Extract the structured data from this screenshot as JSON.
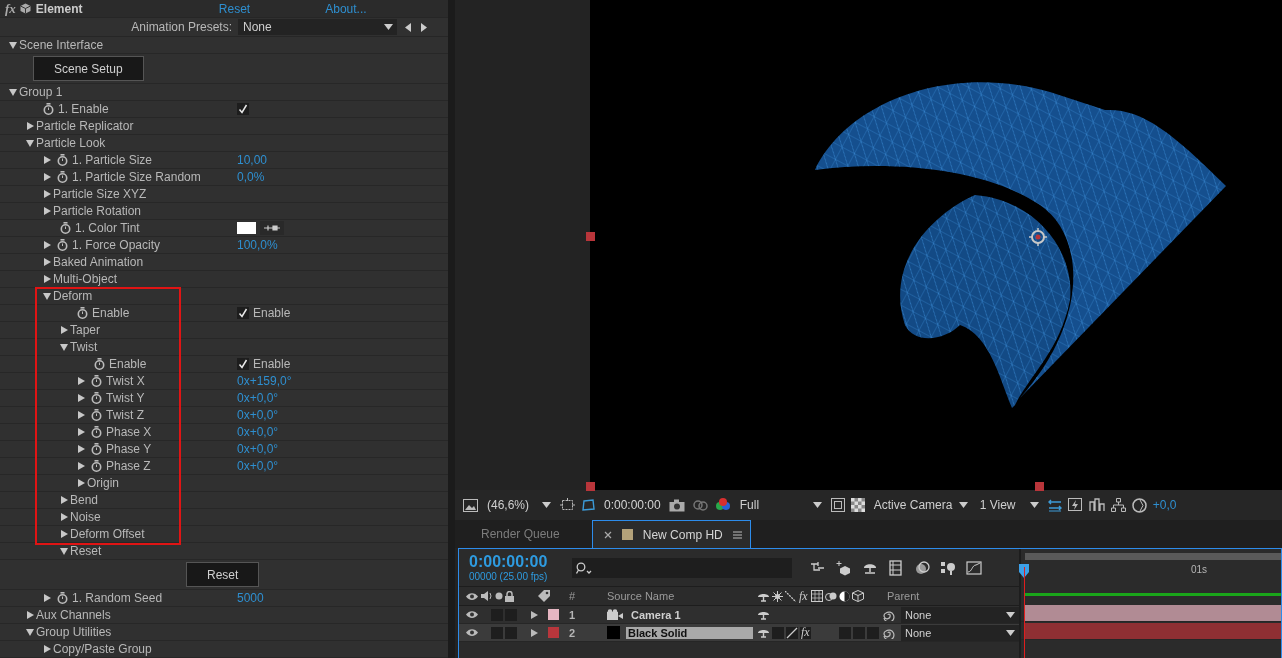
{
  "effect_panel": {
    "badge": "fx",
    "title": "Element",
    "reset_link": "Reset",
    "about_link": "About...",
    "presets_label": "Animation Presets:",
    "presets_value": "None",
    "tree": [
      {
        "kind": "group",
        "label": "Scene Interface",
        "expanded": true,
        "children": [
          {
            "kind": "button",
            "label": "Scene Setup"
          }
        ]
      },
      {
        "kind": "group",
        "label": "Group 1",
        "expanded": true,
        "children": [
          {
            "kind": "param",
            "label": "1. Enable",
            "value": {
              "kind": "checkbox",
              "checked": true
            }
          },
          {
            "kind": "group",
            "label": "Particle Replicator",
            "expanded": false
          },
          {
            "kind": "group",
            "label": "Particle Look",
            "expanded": true,
            "children": [
              {
                "kind": "param",
                "label": "1. Particle Size",
                "expanded": false,
                "value": {
                  "kind": "number",
                  "text": "10,00"
                }
              },
              {
                "kind": "param",
                "label": "1. Particle Size Random",
                "expanded": false,
                "value": {
                  "kind": "number",
                  "text": "0,0%"
                }
              },
              {
                "kind": "group",
                "label": "Particle Size XYZ",
                "expanded": false
              },
              {
                "kind": "group",
                "label": "Particle Rotation",
                "expanded": false
              },
              {
                "kind": "param",
                "label": "1. Color Tint",
                "value": {
                  "kind": "color"
                }
              },
              {
                "kind": "param",
                "label": "1. Force Opacity",
                "expanded": false,
                "value": {
                  "kind": "number",
                  "text": "100,0%"
                }
              },
              {
                "kind": "group",
                "label": "Baked Animation",
                "expanded": false
              },
              {
                "kind": "group",
                "label": "Multi-Object",
                "expanded": false
              },
              {
                "kind": "group",
                "label": "Deform",
                "expanded": true,
                "highlighted": true,
                "children": [
                  {
                    "kind": "param",
                    "label": "Enable",
                    "highlighted": true,
                    "value": {
                      "kind": "checkbox",
                      "checked": true,
                      "label": "Enable"
                    }
                  },
                  {
                    "kind": "group",
                    "label": "Taper",
                    "expanded": false,
                    "highlighted": true
                  },
                  {
                    "kind": "group",
                    "label": "Twist",
                    "expanded": true,
                    "highlighted": true,
                    "children": [
                      {
                        "kind": "param",
                        "label": "Enable",
                        "highlighted": true,
                        "value": {
                          "kind": "checkbox",
                          "checked": true,
                          "label": "Enable"
                        }
                      },
                      {
                        "kind": "param",
                        "label": "Twist X",
                        "expanded": false,
                        "highlighted": true,
                        "value": {
                          "kind": "number",
                          "text": "0x+159,0°"
                        }
                      },
                      {
                        "kind": "param",
                        "label": "Twist Y",
                        "expanded": false,
                        "highlighted": true,
                        "value": {
                          "kind": "number",
                          "text": "0x+0,0°"
                        }
                      },
                      {
                        "kind": "param",
                        "label": "Twist Z",
                        "expanded": false,
                        "highlighted": true,
                        "value": {
                          "kind": "number",
                          "text": "0x+0,0°"
                        }
                      },
                      {
                        "kind": "param",
                        "label": "Phase X",
                        "expanded": false,
                        "highlighted": true,
                        "value": {
                          "kind": "number",
                          "text": "0x+0,0°"
                        }
                      },
                      {
                        "kind": "param",
                        "label": "Phase Y",
                        "expanded": false,
                        "highlighted": true,
                        "value": {
                          "kind": "number",
                          "text": "0x+0,0°"
                        }
                      },
                      {
                        "kind": "param",
                        "label": "Phase Z",
                        "expanded": false,
                        "highlighted": true,
                        "value": {
                          "kind": "number",
                          "text": "0x+0,0°"
                        }
                      },
                      {
                        "kind": "group",
                        "label": "Origin",
                        "expanded": false,
                        "highlighted": true
                      }
                    ]
                  },
                  {
                    "kind": "group",
                    "label": "Bend",
                    "expanded": false,
                    "highlighted": true
                  },
                  {
                    "kind": "group",
                    "label": "Noise",
                    "expanded": false,
                    "highlighted": true
                  },
                  {
                    "kind": "group",
                    "label": "Deform Offset",
                    "expanded": false,
                    "highlighted": true
                  },
                  {
                    "kind": "group",
                    "label": "Reset",
                    "expanded": true,
                    "children": [
                      {
                        "kind": "button",
                        "label": "Reset"
                      }
                    ]
                  }
                ]
              },
              {
                "kind": "param",
                "label": "1. Random Seed",
                "expanded": false,
                "value": {
                  "kind": "number",
                  "text": "5000"
                }
              }
            ]
          },
          {
            "kind": "group",
            "label": "Aux Channels",
            "expanded": false
          },
          {
            "kind": "group",
            "label": "Group Utilities",
            "expanded": true,
            "children": [
              {
                "kind": "group",
                "label": "Copy/Paste Group",
                "expanded": false
              }
            ]
          }
        ]
      }
    ]
  },
  "viewer": {
    "zoom": "(46,6%)",
    "timecode": "0:00:00:00",
    "resolution": "Full",
    "camera": "Active Camera",
    "views": "1 View",
    "exposure": "+0,0"
  },
  "tabs": [
    {
      "label": "Render Queue",
      "selected": false
    },
    {
      "label": "New Comp HD",
      "selected": true
    }
  ],
  "timeline": {
    "timecode": "0:00:00:00",
    "frame_info": "00000 (25.00 fps)",
    "switch_badge": "fx",
    "columns": {
      "number": "#",
      "source_name": "Source Name",
      "parent": "Parent"
    },
    "ruler": [
      "01s"
    ],
    "layers": [
      {
        "number": "1",
        "name": "Camera 1",
        "kind": "camera",
        "color": "#e6b6c2",
        "parent": "None",
        "selected": false
      },
      {
        "number": "2",
        "name": "Black Solid",
        "kind": "solid",
        "color": "#b8363c",
        "parent": "None",
        "selected": true,
        "effects_switch": "fx"
      }
    ]
  }
}
